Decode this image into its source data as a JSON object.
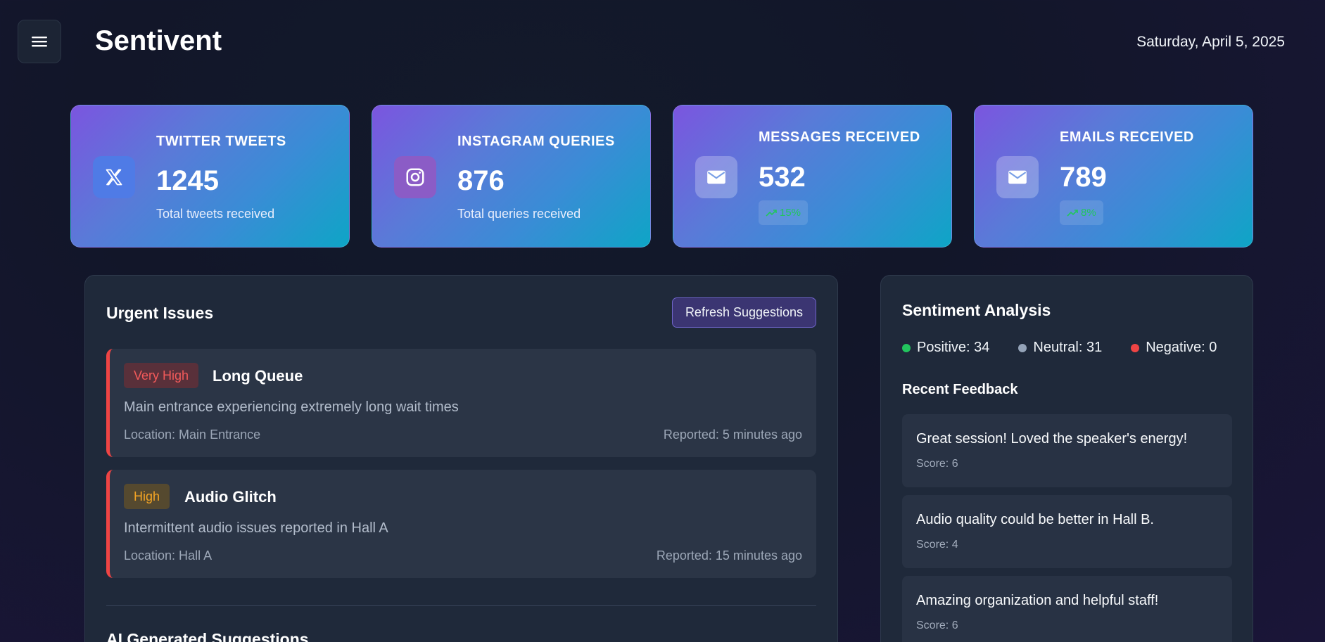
{
  "header": {
    "app_title": "Sentivent",
    "date": "Saturday, April 5, 2025",
    "menu_icon": "hamburger-icon"
  },
  "stats": [
    {
      "icon": "x-logo-icon",
      "label": "TWITTER TWEETS",
      "value": "1245",
      "subtitle": "Total tweets received"
    },
    {
      "icon": "instagram-icon",
      "label": "INSTAGRAM QUERIES",
      "value": "876",
      "subtitle": "Total queries received"
    },
    {
      "icon": "mail-icon",
      "label": "MESSAGES RECEIVED",
      "value": "532",
      "trend": "15%"
    },
    {
      "icon": "mail-icon",
      "label": "EMAILS RECEIVED",
      "value": "789",
      "trend": "8%"
    }
  ],
  "urgent": {
    "title": "Urgent Issues",
    "refresh_label": "Refresh Suggestions",
    "issues": [
      {
        "priority": "Very High",
        "title": "Long Queue",
        "description": "Main entrance experiencing extremely long wait times",
        "location": "Location: Main Entrance",
        "reported": "Reported: 5 minutes ago"
      },
      {
        "priority": "High",
        "title": "Audio Glitch",
        "description": "Intermittent audio issues reported in Hall A",
        "location": "Location: Hall A",
        "reported": "Reported: 15 minutes ago"
      }
    ],
    "ai_title": "AI Generated Suggestions"
  },
  "sentiment": {
    "title": "Sentiment Analysis",
    "positive": "Positive: 34",
    "neutral": "Neutral: 31",
    "negative": "Negative: 0",
    "colors": {
      "positive": "#22c55e",
      "neutral": "#94a3b8",
      "negative": "#ef4444"
    },
    "feedback_title": "Recent Feedback",
    "feedback": [
      {
        "text": "Great session! Loved the speaker's energy!",
        "score": "Score: 6"
      },
      {
        "text": "Audio quality could be better in Hall B.",
        "score": "Score: 4"
      },
      {
        "text": "Amazing organization and helpful staff!",
        "score": "Score: 6"
      }
    ]
  }
}
